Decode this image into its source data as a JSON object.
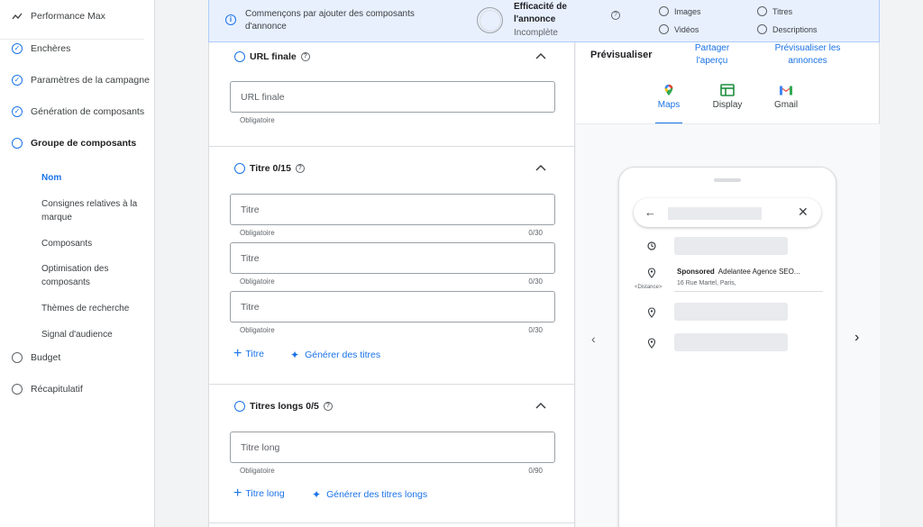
{
  "sidebar": {
    "items": [
      {
        "label": "Performance Max",
        "icon": "trend-icon"
      },
      {
        "label": "Enchères",
        "icon": "check-circle-icon"
      },
      {
        "label": "Paramètres de la campagne",
        "icon": "check-circle-icon"
      },
      {
        "label": "Génération de composants",
        "icon": "check-circle-icon"
      },
      {
        "label": "Groupe de composants",
        "icon": "circle-icon"
      },
      {
        "label": "Budget",
        "icon": "circle-icon"
      },
      {
        "label": "Récapitulatif",
        "icon": "circle-icon"
      }
    ],
    "sub_items": [
      {
        "label": "Nom"
      },
      {
        "label": "Consignes relatives à la marque"
      },
      {
        "label": "Composants"
      },
      {
        "label": "Optimisation des composants"
      },
      {
        "label": "Thèmes de recherche"
      },
      {
        "label": "Signal d'audience"
      }
    ]
  },
  "banner": {
    "message": "Commençons par ajouter des composants d'annonce",
    "effectiveness_title": "Efficacité de l'annonce",
    "effectiveness_status": "Incomplète",
    "checks": [
      "Images",
      "Titres",
      "Vidéos",
      "Descriptions"
    ]
  },
  "form": {
    "url_section": {
      "title": "URL finale",
      "placeholder": "URL finale",
      "hint": "Obligatoire"
    },
    "titles_section": {
      "title": "Titre 0/15",
      "fields": [
        {
          "placeholder": "Titre",
          "hint": "Obligatoire",
          "count": "0/30"
        },
        {
          "placeholder": "Titre",
          "hint": "Obligatoire",
          "count": "0/30"
        },
        {
          "placeholder": "Titre",
          "hint": "Obligatoire",
          "count": "0/30"
        }
      ],
      "add_label": "Titre",
      "generate_label": "Générer des titres"
    },
    "long_titles_section": {
      "title": "Titres longs 0/5",
      "field": {
        "placeholder": "Titre long",
        "hint": "Obligatoire",
        "count": "0/90"
      },
      "add_label": "Titre long",
      "generate_label": "Générer des titres longs"
    }
  },
  "preview": {
    "title": "Prévisualiser",
    "share_link": "Partager l'aperçu",
    "preview_all_link": "Prévisualiser les annonces",
    "tabs": [
      {
        "label": "Maps",
        "active": true
      },
      {
        "label": "Display",
        "active": false
      },
      {
        "label": "Gmail",
        "active": false
      }
    ],
    "ad": {
      "sponsored": "Sponsored",
      "name": "Adelantee Agence SEO...",
      "address": "16 Rue Martel, Paris,",
      "distance": "<Distance>"
    }
  },
  "colors": {
    "accent": "#1a73e8",
    "banner_bg": "#e8f0fe"
  }
}
